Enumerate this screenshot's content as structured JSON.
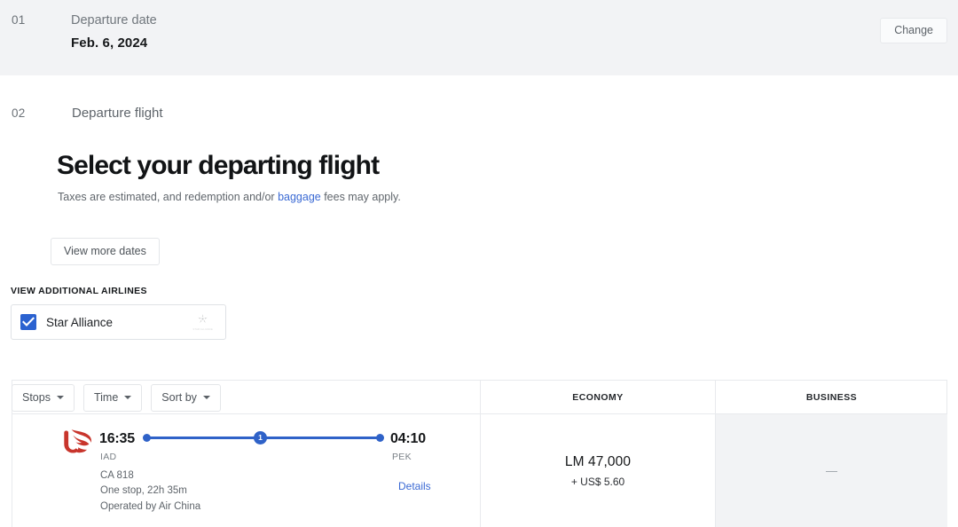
{
  "step1": {
    "number": "01",
    "label": "Departure date",
    "value": "Feb. 6, 2024",
    "change_label": "Change"
  },
  "step2": {
    "number": "02",
    "label": "Departure flight",
    "title": "Select your departing flight",
    "note_before": "Taxes are estimated, and redemption and/or ",
    "note_link": "baggage",
    "note_after": " fees may apply.",
    "view_more_dates_label": "View more dates"
  },
  "airlines": {
    "heading": "VIEW ADDITIONAL AIRLINES",
    "alliance_name": "Star Alliance",
    "alliance_logo_text": "STAR ALLIANCE",
    "checked": "true"
  },
  "filters": [
    {
      "label": "Stops"
    },
    {
      "label": "Time"
    },
    {
      "label": "Sort by"
    }
  ],
  "table": {
    "columns": [
      {
        "key": "flight",
        "header": ""
      },
      {
        "key": "economy",
        "header": "ECONOMY"
      },
      {
        "key": "business",
        "header": "BUSINESS"
      }
    ],
    "rows": [
      {
        "airline_logo": "air-china-phoenix-logo",
        "departure_time": "16:35",
        "departure_airport": "IAD",
        "arrival_time": "04:10",
        "arrival_airport": "PEK",
        "flight_number": "CA 818",
        "stops_duration": "One stop, 22h 35m",
        "operated_by": "Operated by Air China",
        "stop_count": "1",
        "details_label": "Details",
        "economy_price": "LM 47,000",
        "economy_tax": "+ US$ 5.60",
        "business_price": "—"
      }
    ]
  },
  "colors": {
    "accent_blue": "#2f62c8",
    "link_blue": "#3b6ad4",
    "band_gray": "#f2f3f5",
    "airline_red": "#c8352c"
  }
}
